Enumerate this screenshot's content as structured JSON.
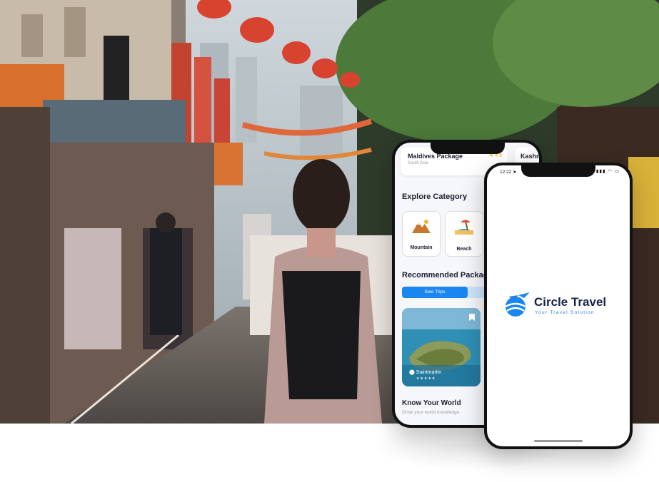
{
  "back_phone": {
    "packages": [
      {
        "title": "Maldives Package",
        "subtitle": "South Asia",
        "rating": "4.6"
      },
      {
        "title": "Kashm"
      }
    ],
    "explore_title": "Explore Category",
    "categories": [
      {
        "label": "Mountain",
        "icon": "mountain-icon"
      },
      {
        "label": "Beach",
        "icon": "beach-icon"
      }
    ],
    "recommended_title": "Recommended Package",
    "tabs": [
      {
        "label": "Solo Trips",
        "active": true
      }
    ],
    "destination": {
      "name": "Saintmartin",
      "stars": "★★★★★"
    },
    "know_title": "Know Your World",
    "know_subtitle": "Grow your world knowledge"
  },
  "front_phone": {
    "status_time": "12:22",
    "brand": "Circle Travel",
    "tagline": "Your Travel Solution",
    "logo_icon": "plane-globe-icon"
  },
  "colors": {
    "accent": "#1a86f0",
    "brand_dark": "#13224a",
    "brand_blue": "#2b7de0"
  }
}
